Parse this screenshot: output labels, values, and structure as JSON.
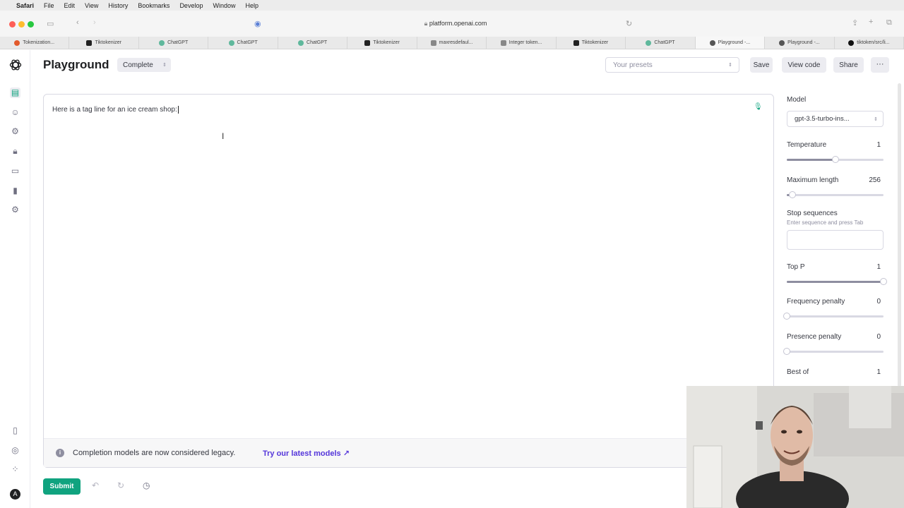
{
  "os_menu": {
    "app": "Safari",
    "items": [
      "File",
      "Edit",
      "View",
      "History",
      "Bookmarks",
      "Develop",
      "Window",
      "Help"
    ]
  },
  "browser": {
    "url": "platform.openai.com",
    "tabs": [
      {
        "label": "Tokenization...",
        "icon": "tz"
      },
      {
        "label": "Tiktokenizer",
        "icon": "tk"
      },
      {
        "label": "ChatGPT",
        "icon": "cg"
      },
      {
        "label": "ChatGPT",
        "icon": "cg"
      },
      {
        "label": "ChatGPT",
        "icon": "cg"
      },
      {
        "label": "Tiktokenizer",
        "icon": "tk"
      },
      {
        "label": "maxresdefaul...",
        "icon": "y"
      },
      {
        "label": "Integer token...",
        "icon": "b"
      },
      {
        "label": "Tiktokenizer",
        "icon": "tk"
      },
      {
        "label": "ChatGPT",
        "icon": "cg"
      },
      {
        "label": "Playground -...",
        "icon": "oa",
        "active": true
      },
      {
        "label": "Playground -...",
        "icon": "oa"
      },
      {
        "label": "tiktoken/src/li...",
        "icon": "gh"
      }
    ]
  },
  "header": {
    "title": "Playground",
    "mode": "Complete",
    "presets_placeholder": "Your presets",
    "save": "Save",
    "view_code": "View code",
    "share": "Share",
    "more": "···"
  },
  "editor": {
    "prompt": "Here is a tag line for an ice cream shop:"
  },
  "notice": {
    "message": "Completion models are now considered legacy.",
    "link": "Try our latest models ↗"
  },
  "footer": {
    "submit": "Submit"
  },
  "settings": {
    "model_label": "Model",
    "model_value": "gpt-3.5-turbo-ins...",
    "temperature_label": "Temperature",
    "temperature_value": "1",
    "temperature_fraction": 0.5,
    "max_length_label": "Maximum length",
    "max_length_value": "256",
    "max_length_fraction": 0.06,
    "stop_label": "Stop sequences",
    "stop_hint": "Enter sequence and press Tab",
    "top_p_label": "Top P",
    "top_p_value": "1",
    "top_p_fraction": 1.0,
    "freq_label": "Frequency penalty",
    "freq_value": "0",
    "freq_fraction": 0.0,
    "presence_label": "Presence penalty",
    "presence_value": "0",
    "presence_fraction": 0.0,
    "best_of_label": "Best of",
    "best_of_value": "1"
  },
  "colors": {
    "accent": "#10a37f",
    "link": "#5436da"
  }
}
